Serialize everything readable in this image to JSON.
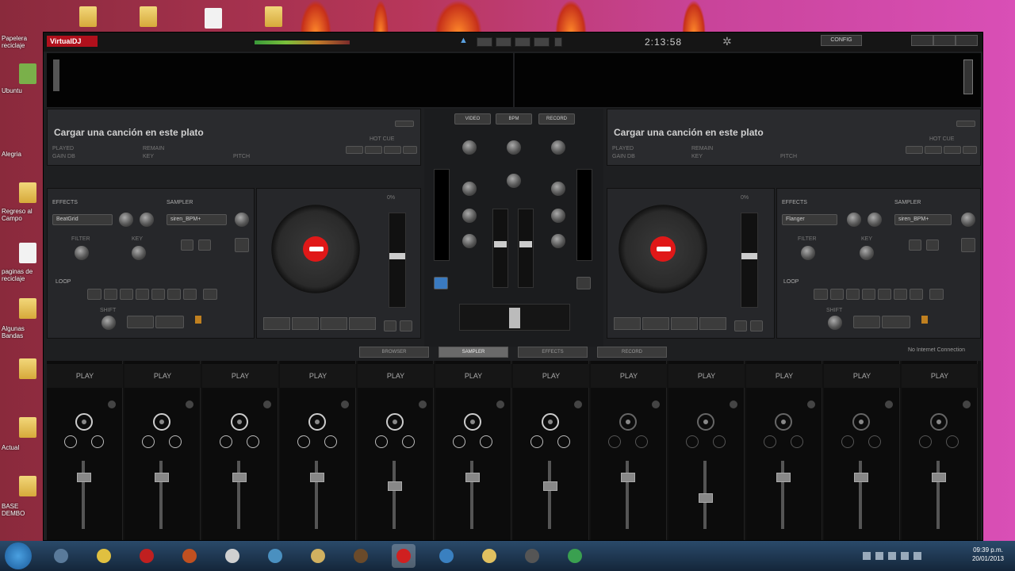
{
  "desktop": {
    "icons": [
      {
        "name": "folder",
        "label": ""
      },
      {
        "name": "folder",
        "label": ""
      },
      {
        "name": "file",
        "label": ""
      },
      {
        "name": "folder",
        "label": ""
      }
    ],
    "side_labels": [
      "Papelera reciclaje",
      "Ubuntu",
      "Alegria",
      "Regreso al Campo",
      "paginas de reciclaje",
      "Algunas Bandas",
      "Actual",
      "BASE DEMBO"
    ]
  },
  "app": {
    "logo": "VirtualDJ",
    "clock": "2:13:58",
    "config_label": "CONFIG",
    "deck_left": {
      "title": "Cargar una canción en este plato",
      "labels": [
        "PLAYED",
        "REMAIN",
        "GAIN dB",
        "KEY",
        "PITCH"
      ],
      "hot_cue": "HOT CUE",
      "effects_label": "EFFECTS",
      "effect_value": "BeatGrid",
      "sampler_label": "SAMPLER",
      "sampler_value": "siren_BPM+",
      "filter_label": "FILTER",
      "key_label": "KEY",
      "loop_label": "LOOP",
      "shift_label": "SHIFT",
      "pitch_value": "0%"
    },
    "deck_right": {
      "title": "Cargar una canción en este plato",
      "labels": [
        "PLAYED",
        "REMAIN",
        "GAIN dB",
        "KEY",
        "PITCH"
      ],
      "hot_cue": "HOT CUE",
      "effects_label": "EFFECTS",
      "effect_value": "Flanger",
      "sampler_label": "SAMPLER",
      "sampler_value": "siren_BPM+",
      "filter_label": "FILTER",
      "key_label": "KEY",
      "loop_label": "LOOP",
      "shift_label": "SHIFT",
      "pitch_value": "0%"
    },
    "mixer": {
      "top_buttons": [
        "VIDEO",
        "BPM",
        "RECORD"
      ]
    },
    "tabs": [
      {
        "label": "BROWSER",
        "active": false
      },
      {
        "label": "SAMPLER",
        "active": true
      },
      {
        "label": "EFFECTS",
        "active": false
      },
      {
        "label": "RECORD",
        "active": false
      }
    ],
    "notice": "No Internet Connection",
    "sampler_slots": [
      {
        "label": "PLAY",
        "loaded": true,
        "level": 0.8
      },
      {
        "label": "PLAY",
        "loaded": true,
        "level": 0.8
      },
      {
        "label": "PLAY",
        "loaded": true,
        "level": 0.8
      },
      {
        "label": "PLAY",
        "loaded": true,
        "level": 0.8
      },
      {
        "label": "PLAY",
        "loaded": true,
        "level": 0.65
      },
      {
        "label": "PLAY",
        "loaded": true,
        "level": 0.8
      },
      {
        "label": "PLAY",
        "loaded": true,
        "level": 0.65
      },
      {
        "label": "PLAY",
        "loaded": false,
        "level": 0.8
      },
      {
        "label": "PLAY",
        "loaded": false,
        "level": 0.45
      },
      {
        "label": "PLAY",
        "loaded": false,
        "level": 0.8
      },
      {
        "label": "PLAY",
        "loaded": false,
        "level": 0.8
      },
      {
        "label": "PLAY",
        "loaded": false,
        "level": 0.8
      }
    ]
  },
  "taskbar": {
    "time": "09:39 p.m.",
    "date": "20/01/2013",
    "apps": [
      "windows-explorer",
      "chrome",
      "opera",
      "media",
      "weather",
      "chrome-alt",
      "folder",
      "user",
      "virtualdj",
      "itunes",
      "paint",
      "camera",
      "skype"
    ],
    "active_index": 8
  },
  "colors": {
    "accent": "#e01818",
    "panel": "#26272a"
  }
}
